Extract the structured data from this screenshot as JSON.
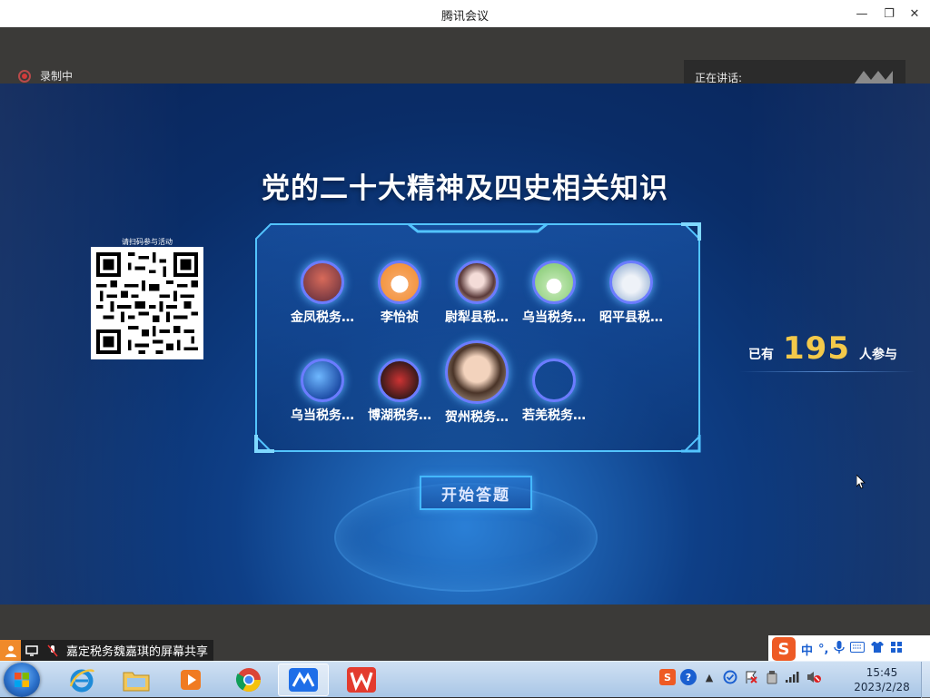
{
  "window": {
    "title": "腾讯会议"
  },
  "recording": {
    "label": "录制中"
  },
  "speaking": {
    "label": "正在讲话:"
  },
  "stage": {
    "title": "党的二十大精神及四史相关知识",
    "qr_label": "请扫码参与活动",
    "participants_row1": [
      "金凤税务…",
      "李怡祯",
      "尉犁县税…",
      "乌当税务…",
      "昭平县税…"
    ],
    "participants_row2": [
      "乌当税务…",
      "博湖税务…",
      "贺州税务…",
      "若羌税务…"
    ],
    "count_prefix": "已有",
    "count_value": "195",
    "count_suffix": "人参与",
    "start_button": "开始答题"
  },
  "share": {
    "text": "嘉定税务魏嘉琪的屏幕共享"
  },
  "ime": {
    "mode": "中",
    "punct": "°,"
  },
  "taskbar": {
    "apps": [
      "internet-explorer",
      "file-explorer",
      "media-player",
      "chrome",
      "tencent-meeting",
      "wps-office"
    ]
  },
  "clock": {
    "time": "15:45",
    "date": "2023/2/28"
  },
  "colors": {
    "accent": "#44b8ff",
    "count": "#f3c94a",
    "stage": "#0e3f87"
  }
}
